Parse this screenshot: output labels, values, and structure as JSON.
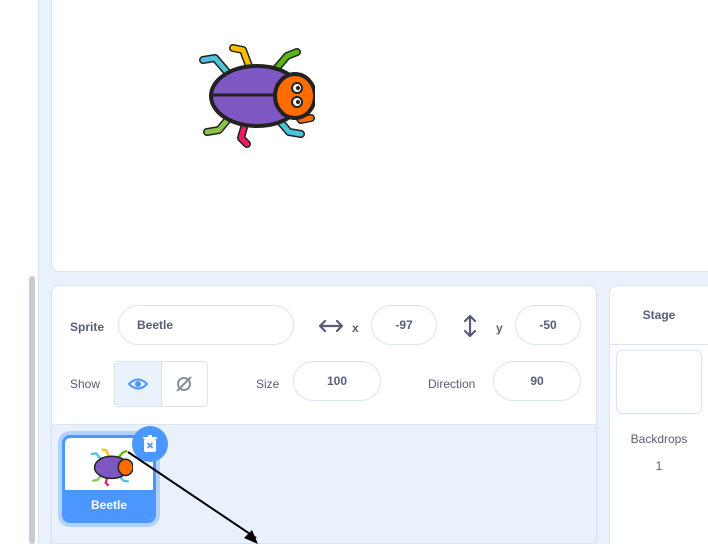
{
  "sprite_info": {
    "sprite_label": "Sprite",
    "sprite_name": "Beetle",
    "x_label": "x",
    "x_value": "-97",
    "y_label": "y",
    "y_value": "-50",
    "show_label": "Show",
    "size_label": "Size",
    "size_value": "100",
    "direction_label": "Direction",
    "direction_value": "90"
  },
  "sprite_list": {
    "items": [
      {
        "name": "Beetle",
        "selected": true
      }
    ]
  },
  "stage_panel": {
    "title": "Stage",
    "backdrops_label": "Backdrops",
    "backdrops_count": "1"
  },
  "icons": {
    "x_axis": "horizontal-arrows-icon",
    "y_axis": "vertical-arrows-icon",
    "show_visible": "eye-icon",
    "show_hidden": "eye-slash-icon",
    "delete": "trash-icon",
    "sprite": "beetle-icon"
  },
  "colors": {
    "accent": "#4c97ff",
    "text": "#575e75",
    "panel_bg": "#e9f1fc",
    "border": "#d9e3f2"
  }
}
